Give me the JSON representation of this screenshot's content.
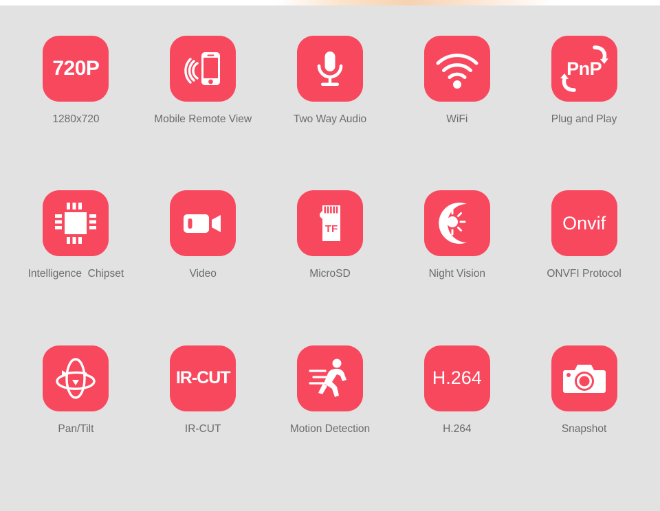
{
  "page": {
    "background_color": "#e2e2e2",
    "tile_color": "#f8485e",
    "label_color": "#6b6b6b",
    "icon_color": "#ffffff"
  },
  "features": [
    {
      "icon": "resolution-720p-icon",
      "tile_text": "720P",
      "label": "1280x720"
    },
    {
      "icon": "mobile-remote-view-icon",
      "tile_text": "",
      "label": "Mobile Remote View"
    },
    {
      "icon": "microphone-icon",
      "tile_text": "",
      "label": "Two Way Audio"
    },
    {
      "icon": "wifi-icon",
      "tile_text": "",
      "label": "WiFi"
    },
    {
      "icon": "plug-and-play-icon",
      "tile_text": "PnP",
      "label": "Plug and Play"
    },
    {
      "icon": "chipset-icon",
      "tile_text": "",
      "label": "Intelligence  Chipset"
    },
    {
      "icon": "video-camera-icon",
      "tile_text": "",
      "label": "Video"
    },
    {
      "icon": "tf-card-icon",
      "tile_text": "TF",
      "label": "MicroSD"
    },
    {
      "icon": "night-vision-icon",
      "tile_text": "",
      "label": "Night Vision"
    },
    {
      "icon": "onvif-icon",
      "tile_text": "Onvif",
      "label": "ONVFI Protocol"
    },
    {
      "icon": "pan-tilt-icon",
      "tile_text": "",
      "label": "Pan/Tilt"
    },
    {
      "icon": "ir-cut-icon",
      "tile_text": "IR-CUT",
      "label": "IR-CUT"
    },
    {
      "icon": "motion-detection-icon",
      "tile_text": "",
      "label": "Motion Detection"
    },
    {
      "icon": "h264-icon",
      "tile_text": "H.264",
      "label": "H.264"
    },
    {
      "icon": "snapshot-camera-icon",
      "tile_text": "",
      "label": "Snapshot"
    }
  ]
}
